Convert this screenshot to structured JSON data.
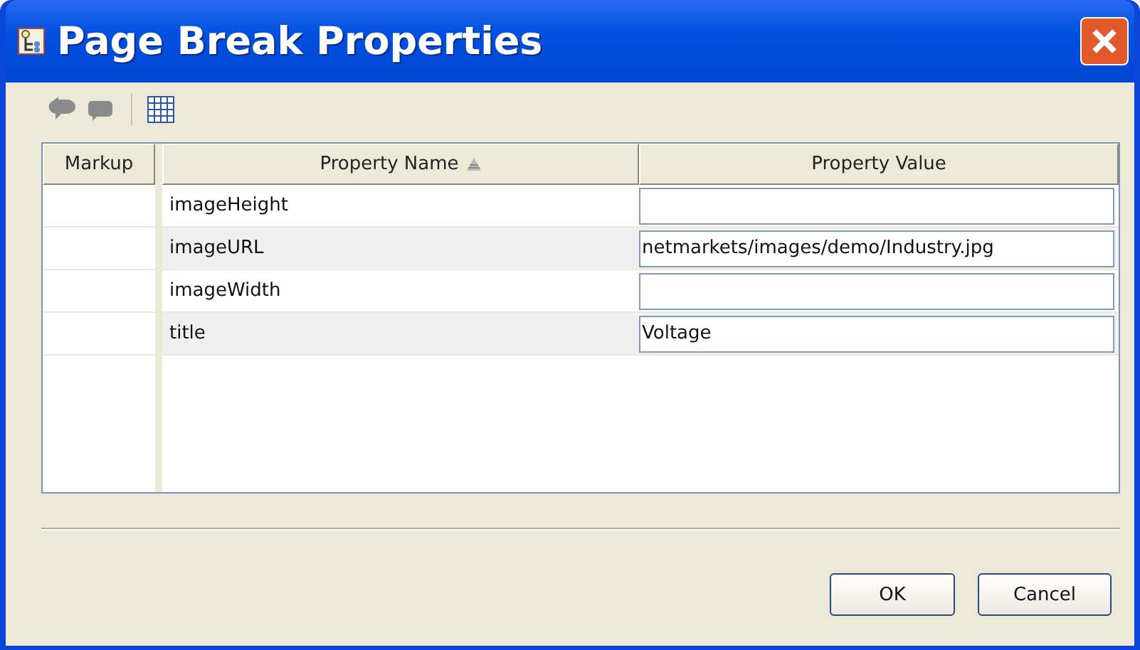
{
  "window": {
    "title": "Page Break Properties"
  },
  "table": {
    "columns": [
      {
        "label": "Markup",
        "sorted": false
      },
      {
        "label": "Property Name",
        "sorted": true
      },
      {
        "label": "Property Value",
        "sorted": false
      }
    ],
    "rows": [
      {
        "name": "imageHeight",
        "value": ""
      },
      {
        "name": "imageURL",
        "value": "netmarkets/images/demo/Industry.jpg"
      },
      {
        "name": "imageWidth",
        "value": ""
      },
      {
        "name": "title",
        "value": "Voltage"
      }
    ]
  },
  "buttons": [
    "OK",
    "Cancel"
  ]
}
